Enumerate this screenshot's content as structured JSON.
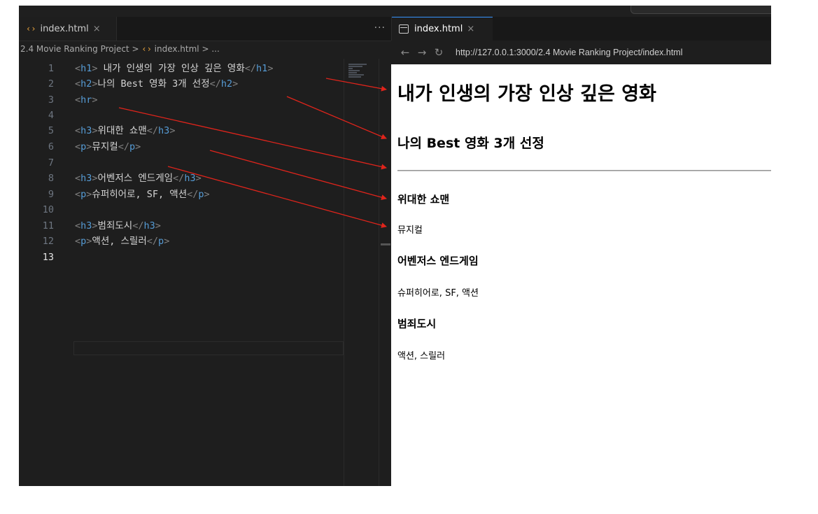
{
  "editor": {
    "tab": {
      "icon": "html-file-icon",
      "label": "index.html"
    },
    "more_label": "···",
    "breadcrumb": {
      "folder": "2.4 Movie Ranking Project",
      "sep": ">",
      "file": "index.html",
      "tail": "..."
    },
    "lines": [
      {
        "n": "1",
        "open": "<h1>",
        "text": " 내가 인생의 가장 인상 깊은 영화",
        "close": "</h1>"
      },
      {
        "n": "2",
        "open": "<h2>",
        "text": "나의 Best 영화 3개 선정",
        "close": "</h2>"
      },
      {
        "n": "3",
        "open": "<hr>",
        "text": "",
        "close": ""
      },
      {
        "n": "4",
        "open": "",
        "text": "",
        "close": ""
      },
      {
        "n": "5",
        "open": "<h3>",
        "text": "위대한 쇼맨",
        "close": "</h3>"
      },
      {
        "n": "6",
        "open": "<p>",
        "text": "뮤지컬",
        "close": "</p>"
      },
      {
        "n": "7",
        "open": "",
        "text": "",
        "close": ""
      },
      {
        "n": "8",
        "open": "<h3>",
        "text": "어벤저스 엔드게임",
        "close": "</h3>"
      },
      {
        "n": "9",
        "open": "<p>",
        "text": "슈퍼히어로, SF, 액션",
        "close": "</p>"
      },
      {
        "n": "10",
        "open": "",
        "text": "",
        "close": ""
      },
      {
        "n": "11",
        "open": "<h3>",
        "text": "범죄도시",
        "close": "</h3>"
      },
      {
        "n": "12",
        "open": "<p>",
        "text": "액션, 스릴러",
        "close": "</p>"
      },
      {
        "n": "13",
        "open": "",
        "text": "",
        "close": ""
      }
    ],
    "active_line": "13"
  },
  "preview": {
    "tab": {
      "icon": "preview-icon",
      "label": "index.html"
    },
    "url": "http://127.0.0.1:3000/2.4 Movie Ranking Project/index.html",
    "page": {
      "h1": "내가 인생의 가장 인상 깊은 영화",
      "h2": "나의 Best 영화 3개 선정",
      "movies": [
        {
          "title": "위대한 쇼맨",
          "genre": "뮤지컬"
        },
        {
          "title": "어벤저스 엔드게임",
          "genre": "슈퍼히어로, SF, 액션"
        },
        {
          "title": "범죄도시",
          "genre": "액션, 스릴러"
        }
      ]
    }
  },
  "colors": {
    "tag": "#569cd6",
    "bracket": "#808080",
    "text": "#d4d4d4",
    "arrow": "#e0241b",
    "accent": "#3794ff"
  }
}
